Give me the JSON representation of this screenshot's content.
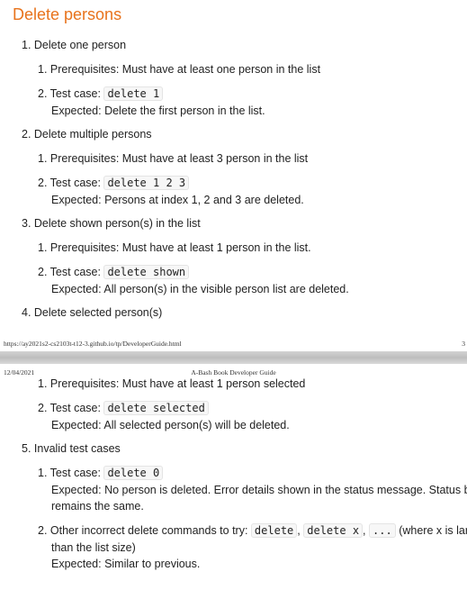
{
  "page1": {
    "heading": "Delete persons",
    "items": [
      {
        "label": "1. Delete one person",
        "sub": [
          {
            "text": "1. Prerequisites: Must have at least one person in the list"
          },
          {
            "prefix": "2. Test case:",
            "code": "delete 1",
            "expected": "Expected: Delete the first person in the list."
          }
        ]
      },
      {
        "label": "2. Delete multiple persons",
        "sub": [
          {
            "text": "1. Prerequisites: Must have at least 3 person in the list"
          },
          {
            "prefix": "2. Test case:",
            "code": "delete 1 2 3",
            "expected": "Expected: Persons at index 1, 2 and 3 are deleted."
          }
        ]
      },
      {
        "label": "3. Delete shown person(s) in the list",
        "sub": [
          {
            "text": "1. Prerequisites: Must have at least 1 person in the list."
          },
          {
            "prefix": "2. Test case:",
            "code": "delete shown",
            "expected": "Expected: All person(s) in the visible person list are deleted."
          }
        ]
      },
      {
        "label": "4. Delete selected person(s)"
      }
    ],
    "footer_url": "https://ay2021s2-cs2103t-t12-3.github.io/tp/DeveloperGuide.html",
    "page_number": "3"
  },
  "page2": {
    "header_date": "12/04/2021",
    "header_title": "A-Bash Book Developer Guide",
    "cont": [
      {
        "text": "1. Prerequisites: Must have at least 1 person selected"
      },
      {
        "prefix": "2. Test case:",
        "code": "delete selected",
        "expected": "Expected: All selected person(s) will be deleted."
      }
    ],
    "item5": {
      "label": "5. Invalid test cases",
      "sub1": {
        "prefix": "1. Test case:",
        "code": "delete 0",
        "expected_line1": "Expected: No person is deleted. Error details shown in the status message. Status bar",
        "expected_line2": "remains the same."
      },
      "sub2": {
        "prefix": "2. Other incorrect delete commands to try:",
        "code1": "delete",
        "sep1": ",",
        "code2": "delete x",
        "sep2": ",",
        "code3": "...",
        "suffix": "(where x is larger",
        "line2": "than the list size)",
        "expected": "Expected: Similar to previous."
      }
    }
  }
}
